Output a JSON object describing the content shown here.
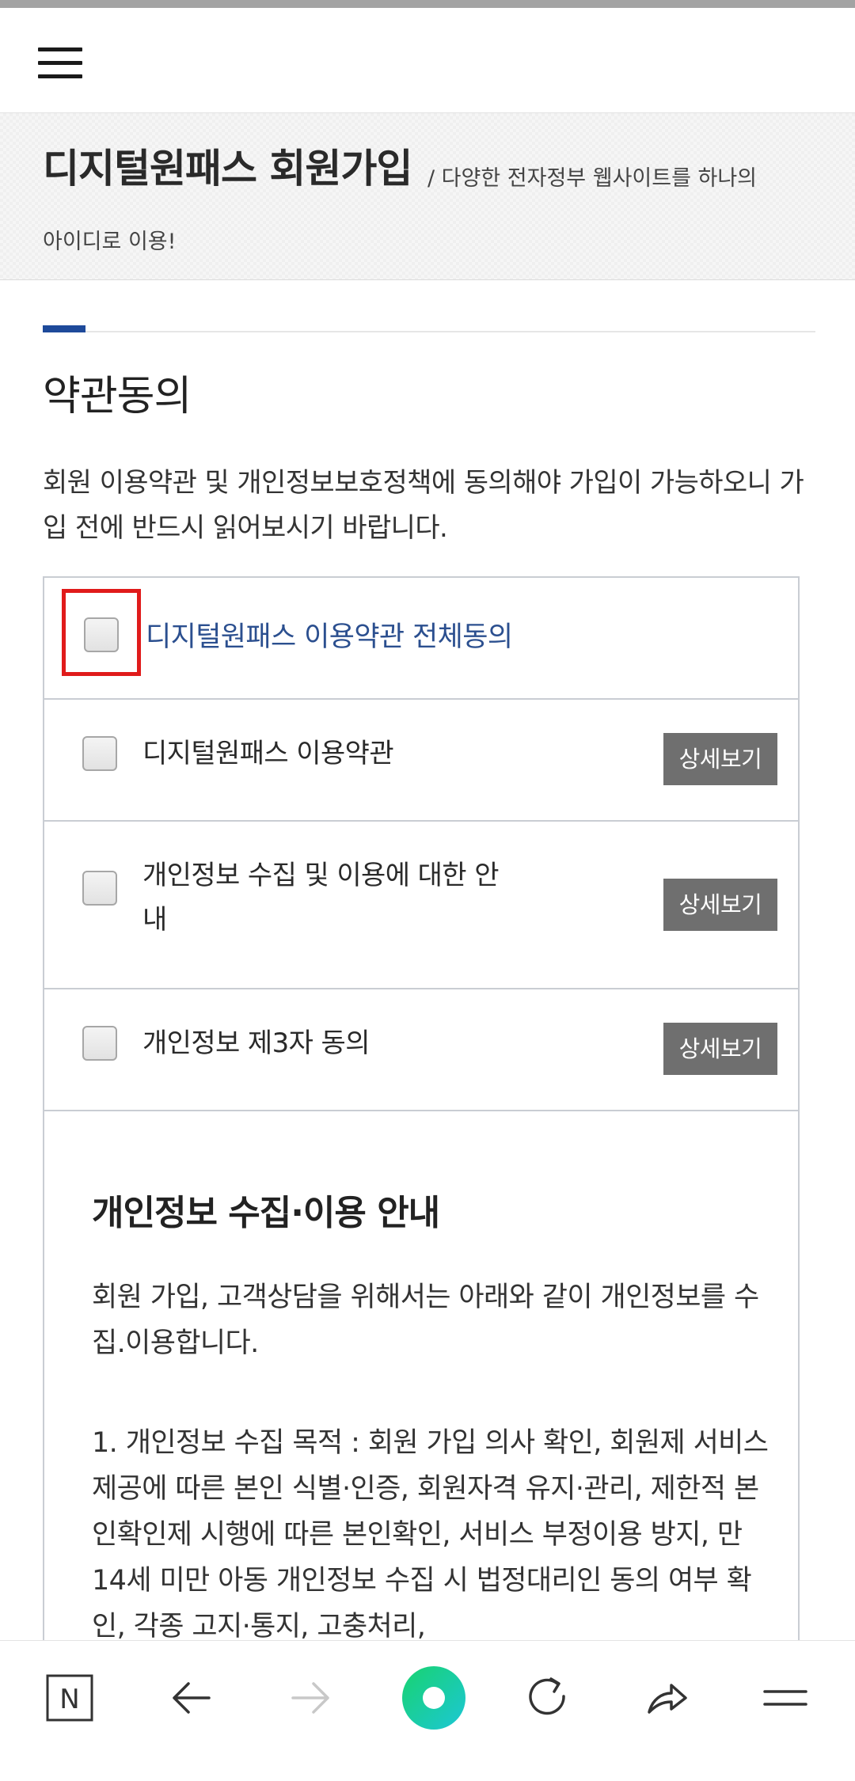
{
  "header": {
    "menu_icon": "hamburger-menu-icon"
  },
  "title_band": {
    "title": "디지털원패스 회원가입",
    "subtitle_line1": "/ 다양한 전자정부 웹사이트를 하나의",
    "subtitle_line2": "아이디로 이용!"
  },
  "section": {
    "title": "약관동의",
    "description": "회원 이용약관 및 개인정보보호정책에 동의해야 가입이 가능하오니 가입 전에 반드시 읽어보시기 바랍니다."
  },
  "terms": {
    "all_agree_label": "디지털원패스 이용약관 전체동의",
    "detail_label": "상세보기",
    "items": [
      {
        "label": "디지털원패스 이용약관"
      },
      {
        "label": "개인정보 수집 및 이용에 대한 안내"
      },
      {
        "label": "개인정보 제3자 동의"
      }
    ]
  },
  "privacy": {
    "title": "개인정보 수집·이용 안내",
    "paragraph1": "회원 가입, 고객상담을 위해서는 아래와 같이 개인정보를 수집.이용합니다.",
    "paragraph2": "1. 개인정보 수집 목적 : 회원 가입 의사 확인, 회원제 서비스 제공에 따른 본인 식별·인증, 회원자격 유지·관리, 제한적 본인확인제 시행에 따른 본인확인, 서비스 부정이용 방지, 만14세 미만 아동 개인정보 수집 시 법정대리인 동의 여부 확인, 각종 고지·통지, 고충처리,"
  },
  "browser_nav": {
    "icons": [
      "naver-n-icon",
      "back-arrow-icon",
      "forward-arrow-icon",
      "green-circle-home-icon",
      "refresh-icon",
      "share-icon",
      "menu-lines-icon"
    ],
    "n_label": "N",
    "colors": {
      "accent_green": "#19d39a",
      "accent_teal": "#1cc7d6"
    }
  },
  "colors": {
    "accent_blue": "#1e4a9a",
    "link_blue": "#2b4f8f",
    "highlight_red": "#e01b1b",
    "button_gray": "#6f6f6f"
  }
}
